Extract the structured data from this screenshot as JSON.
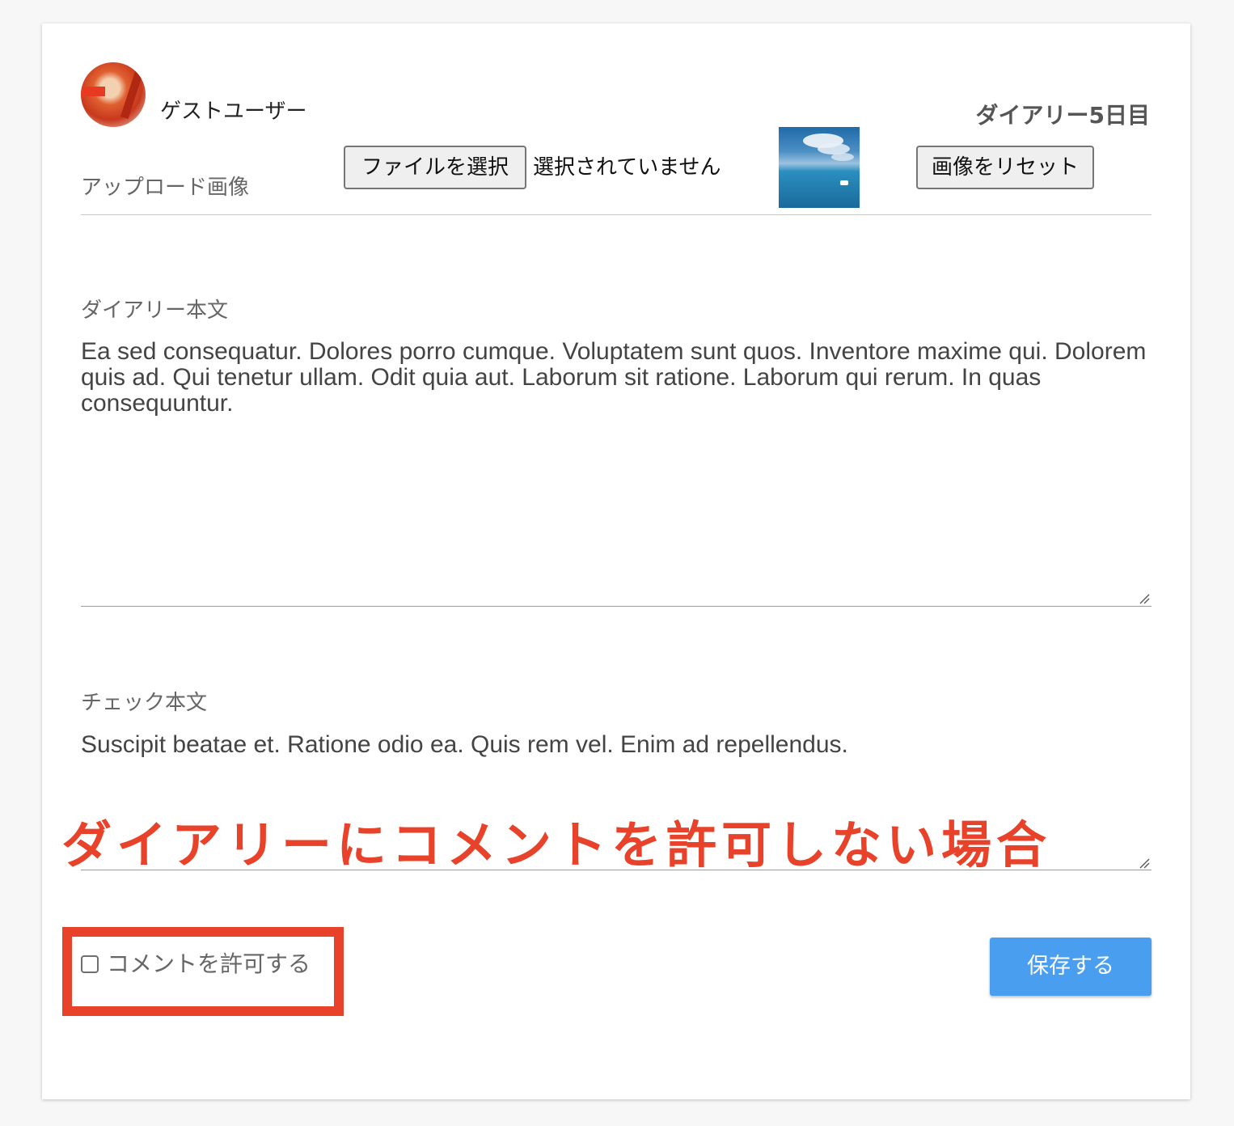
{
  "user": {
    "name": "ゲストユーザー"
  },
  "diary": {
    "title": "ダイアリー5日目"
  },
  "upload": {
    "label": "アップロード画像",
    "choose_file_button": "ファイルを選択",
    "file_status": "選択されていません",
    "reset_button": "画像をリセット"
  },
  "body_field": {
    "label": "ダイアリー本文",
    "value": "Ea sed consequatur. Dolores porro cumque. Voluptatem sunt quos. Inventore maxime qui. Dolorem quis ad. Qui tenetur ullam. Odit quia aut. Laborum sit ratione. Laborum qui rerum. In quas consequuntur."
  },
  "check_field": {
    "label": "チェック本文",
    "value": "Suscipit beatae et. Ratione odio ea. Quis rem vel. Enim ad repellendus."
  },
  "annotation": {
    "text": "ダイアリーにコメントを許可しない場合"
  },
  "allow_comments": {
    "label": "コメントを許可する",
    "checked": false
  },
  "save_button": {
    "label": "保存する"
  },
  "colors": {
    "accent": "#4a9ef0",
    "annotation": "#e8432a"
  }
}
